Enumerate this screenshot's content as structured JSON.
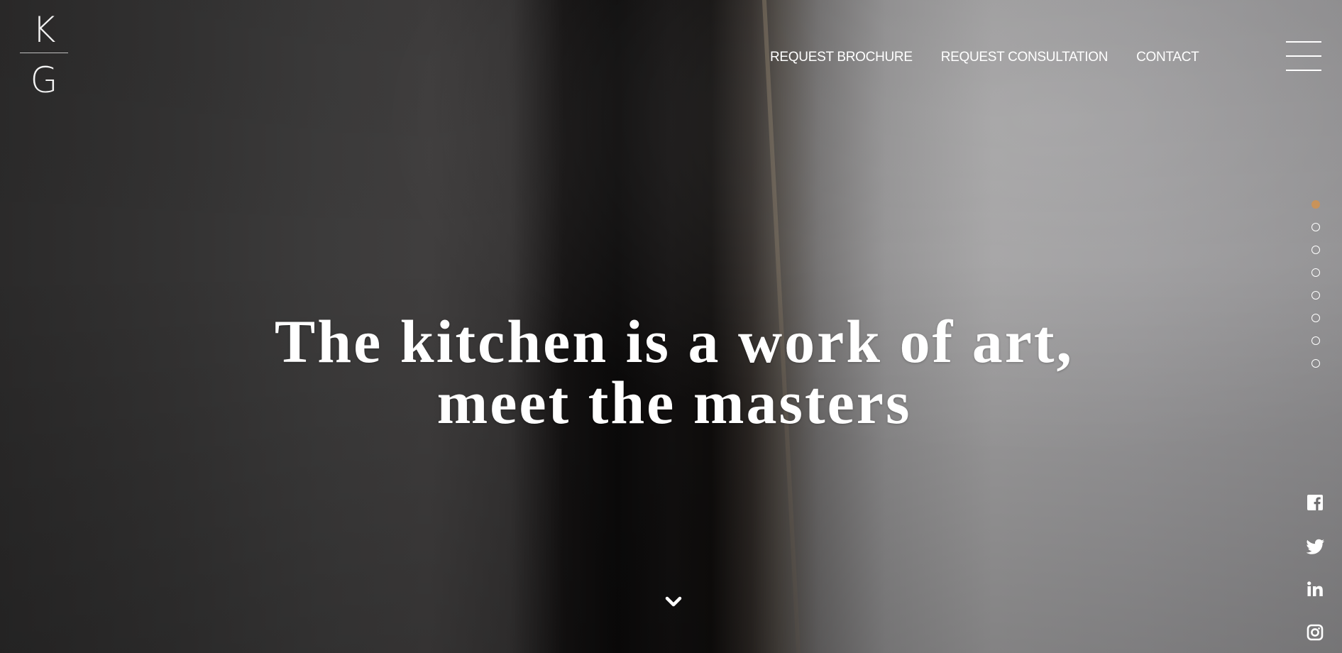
{
  "brand": {
    "logo_top": "K",
    "logo_bottom": "G"
  },
  "nav": {
    "items": [
      {
        "label": "REQUEST BROCHURE"
      },
      {
        "label": "REQUEST CONSULTATION"
      },
      {
        "label": "CONTACT"
      }
    ],
    "menu_icon": "hamburger-icon"
  },
  "hero": {
    "headline_line1": "The kitchen is a work of art,",
    "headline_line2": "meet the masters",
    "scroll_icon": "chevron-down-icon"
  },
  "slides": {
    "count": 8,
    "active_index": 0,
    "active_color": "#c9935a",
    "inactive_color": "transparent"
  },
  "social": [
    {
      "icon": "facebook-icon"
    },
    {
      "icon": "twitter-icon"
    },
    {
      "icon": "linkedin-icon"
    },
    {
      "icon": "instagram-icon"
    }
  ],
  "colors": {
    "text": "#ffffff",
    "accent": "#c9935a"
  }
}
